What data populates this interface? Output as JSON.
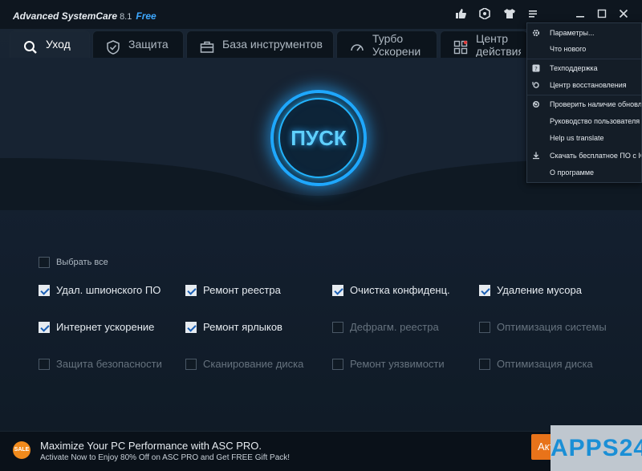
{
  "app": {
    "name": "Advanced SystemCare",
    "version": "8.1",
    "edition": "Free"
  },
  "tabs": [
    {
      "label": "Уход",
      "active": true
    },
    {
      "label": "Защита",
      "active": false
    },
    {
      "label": "База инструментов",
      "active": false
    },
    {
      "label": "Турбо Ускорени",
      "active": false
    },
    {
      "label": "Центр действия",
      "active": false
    }
  ],
  "go_button": {
    "label": "ПУСК"
  },
  "select_all": {
    "label": "Выбрать все",
    "checked": false
  },
  "checkboxes": [
    {
      "label": "Удал. шпионского ПО",
      "checked": true
    },
    {
      "label": "Ремонт реестра",
      "checked": true
    },
    {
      "label": "Очистка конфиденц.",
      "checked": true
    },
    {
      "label": "Удаление мусора",
      "checked": true
    },
    {
      "label": "Интернет ускорение",
      "checked": true
    },
    {
      "label": "Ремонт ярлыков",
      "checked": true
    },
    {
      "label": "Дефрагм. реестра",
      "checked": false
    },
    {
      "label": "Оптимизация системы",
      "checked": false
    },
    {
      "label": "Защита безопасности",
      "checked": false
    },
    {
      "label": "Сканирование диска",
      "checked": false
    },
    {
      "label": "Ремонт уязвимости",
      "checked": false
    },
    {
      "label": "Оптимизация диска",
      "checked": false
    }
  ],
  "menu": {
    "items": [
      {
        "label": "Параметры...",
        "icon": "gear-icon"
      },
      {
        "label": "Что нового",
        "icon": ""
      },
      {
        "label": "Техподдержка",
        "icon": "help-icon"
      },
      {
        "label": "Центр восстановления",
        "icon": "restore-icon"
      },
      {
        "label": "Проверить наличие обновлений",
        "icon": "update-icon"
      },
      {
        "label": "Руководство пользователя",
        "icon": ""
      },
      {
        "label": "Help us translate",
        "icon": ""
      },
      {
        "label": "Скачать бесплатное ПО с IObit",
        "icon": "download-icon"
      },
      {
        "label": "О программе",
        "icon": ""
      }
    ]
  },
  "promo": {
    "badge": "SALE",
    "line1": "Maximize Your PC Performance with ASC PRO.",
    "line2": "Activate Now to Enjoy 80% Off on ASC PRO and Get FREE Gift Pack!",
    "button": "Акти"
  },
  "watermark": "APPS24",
  "colors": {
    "accent": "#1fa8ff",
    "activate": "#e8731a",
    "background": "#1a2634"
  }
}
